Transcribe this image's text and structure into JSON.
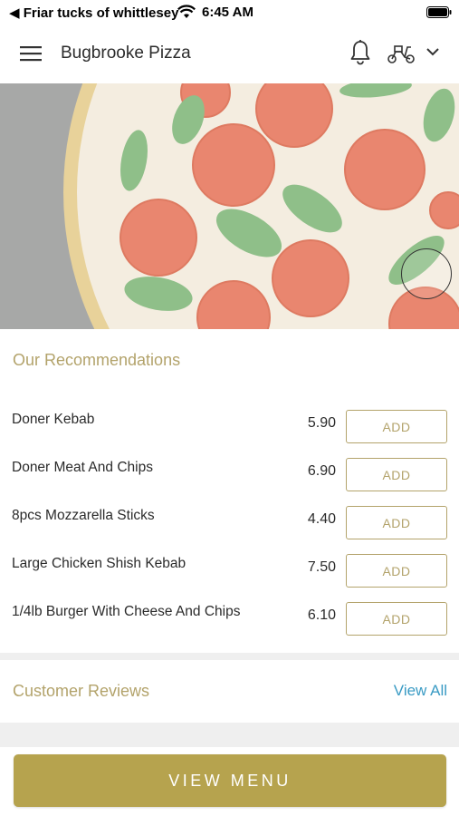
{
  "status_bar": {
    "back_label": "◀ Friar tucks of whittlesey",
    "time": "6:45 AM",
    "icons": [
      "wifi-icon",
      "battery-icon"
    ]
  },
  "header": {
    "title": "Bugbrooke Pizza",
    "icons": [
      "menu-icon",
      "bell-icon",
      "scooter-icon",
      "chevron-down-icon"
    ]
  },
  "hero": {
    "image": "pizza-banner"
  },
  "recommendations": {
    "title": "Our Recommendations",
    "items": [
      {
        "name": "Doner Kebab",
        "price": "5.90",
        "button": "ADD"
      },
      {
        "name": "Doner Meat And Chips",
        "price": "6.90",
        "button": "ADD"
      },
      {
        "name": "8pcs Mozzarella Sticks",
        "price": "4.40",
        "button": "ADD"
      },
      {
        "name": "Large Chicken Shish Kebab",
        "price": "7.50",
        "button": "ADD"
      },
      {
        "name": "1/4lb Burger With Cheese And Chips",
        "price": "6.10",
        "button": "ADD"
      }
    ]
  },
  "reviews": {
    "title": "Customer Reviews",
    "view_all": "View All"
  },
  "footer": {
    "view_menu": "VIEW MENU"
  },
  "colors": {
    "accent_gold": "#b6a34e",
    "text_gold": "#b3a36b",
    "link_blue": "#3a9bc4"
  }
}
